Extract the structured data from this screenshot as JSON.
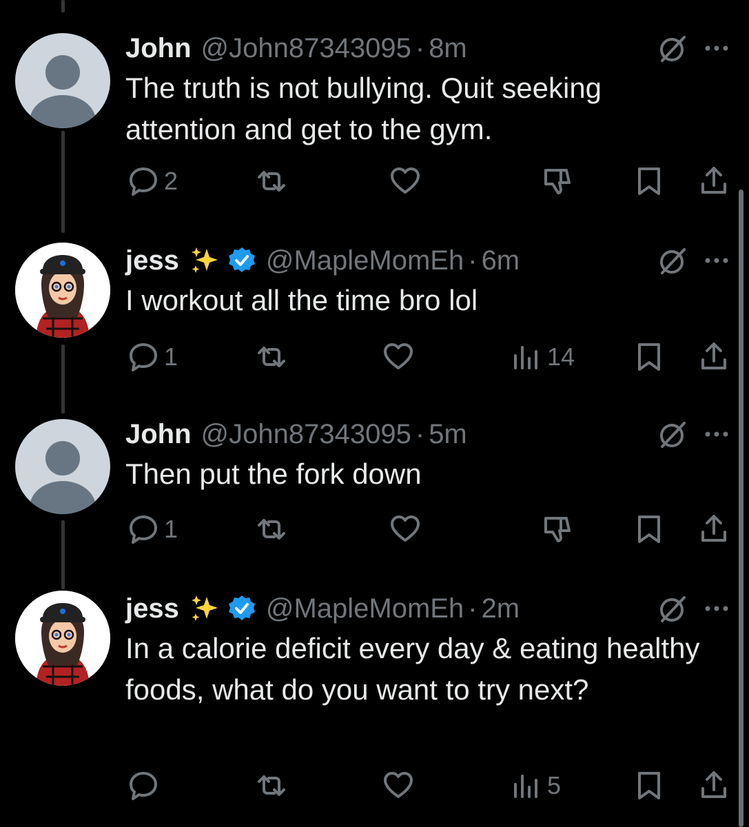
{
  "posts": [
    {
      "name": "John",
      "handle": "@John87343095",
      "dot": "·",
      "time": "8m",
      "text": "The truth is not bullying.  Quit seeking attention and get to the gym.",
      "reply_count": "2",
      "views": ""
    },
    {
      "name": "jess",
      "handle": "@MapleMomEh",
      "dot": "·",
      "time": "6m",
      "text": "I workout all the time bro lol",
      "reply_count": "1",
      "views": "14"
    },
    {
      "name": "John",
      "handle": "@John87343095",
      "dot": "·",
      "time": "5m",
      "text": "Then put the fork down",
      "reply_count": "1",
      "views": ""
    },
    {
      "name": "jess",
      "handle": "@MapleMomEh",
      "dot": "·",
      "time": "2m",
      "text": "In a calorie deficit every day & eating healthy foods, what do you want to try next?",
      "reply_count": "",
      "views": "5"
    }
  ],
  "colors": {
    "background": "#000000",
    "text": "#e7e9ea",
    "muted": "#71767b",
    "verified": "#1d9bf0",
    "thread_line": "#333639"
  },
  "icons": {
    "reply": "reply-icon",
    "repost": "repost-icon",
    "like": "heart-icon",
    "views": "views-icon",
    "downvote": "downvote-icon",
    "bookmark": "bookmark-icon",
    "share": "share-icon",
    "grok": "grok-icon",
    "more": "more-icon"
  }
}
